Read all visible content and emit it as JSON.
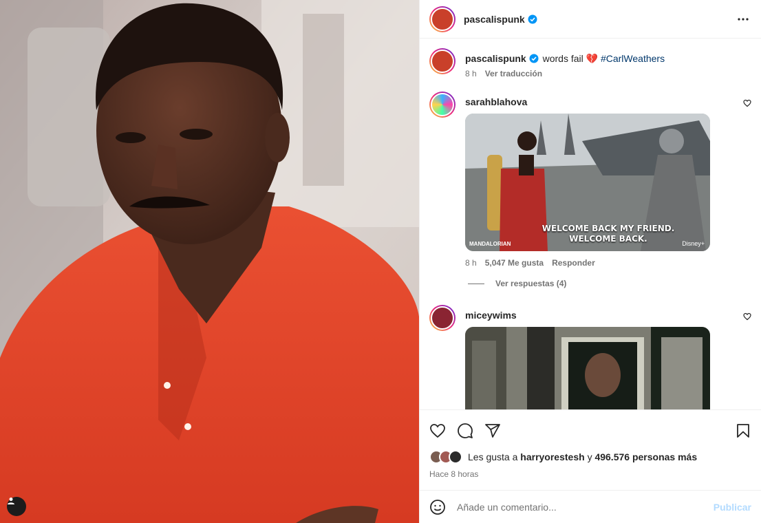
{
  "post": {
    "author": "pascalispunk",
    "caption": "words fail",
    "caption_emoji": "💔",
    "hashtag": "#CarlWeathers",
    "time": "8 h",
    "translate": "Ver traducción"
  },
  "comments": [
    {
      "user": "sarahblahova",
      "gif_text_line1": "WELCOME BACK MY FRIEND.",
      "gif_text_line2": "WELCOME BACK.",
      "gif_logo": "MANDALORIAN",
      "gif_watermark": "Disney+",
      "time": "8 h",
      "likes": "5,047 Me gusta",
      "reply": "Responder",
      "view_replies": "Ver respuestas (4)"
    },
    {
      "user": "miceywims"
    }
  ],
  "likes_summary": {
    "prefix": "Les gusta a",
    "user": "harryorestesh",
    "connector": "y",
    "count": "496.576 personas más"
  },
  "posted_ago": "Hace 8 horas",
  "comment_box": {
    "placeholder": "Añade un comentario...",
    "publish": "Publicar"
  },
  "colors": {
    "verified": "#0095f6",
    "link": "#00376b",
    "publish_disabled": "#b3dbff",
    "shirt": "#e2442c"
  },
  "icons": [
    "heart-icon",
    "comment-icon",
    "share-icon",
    "bookmark-icon",
    "emoji-icon",
    "more-icon",
    "verified-icon",
    "user-tag-icon"
  ]
}
